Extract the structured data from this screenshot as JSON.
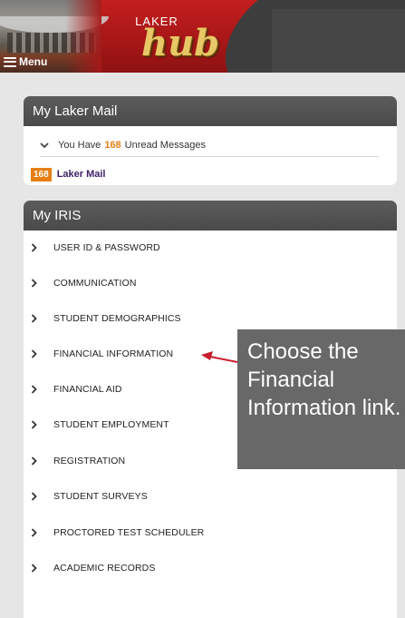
{
  "header": {
    "menu_label": "Menu",
    "logo_top": "LAKER",
    "logo_main": "hub"
  },
  "mail_panel": {
    "title": "My Laker Mail",
    "summary_prefix": "You Have",
    "unread_count": "168",
    "summary_suffix": "Unread Messages",
    "badge": "168",
    "link_label": "Laker Mail"
  },
  "iris_panel": {
    "title": "My IRIS",
    "items": [
      {
        "label": "USER ID & PASSWORD"
      },
      {
        "label": "COMMUNICATION"
      },
      {
        "label": "STUDENT DEMOGRAPHICS"
      },
      {
        "label": "FINANCIAL INFORMATION"
      },
      {
        "label": "FINANCIAL AID"
      },
      {
        "label": "STUDENT EMPLOYMENT"
      },
      {
        "label": "REGISTRATION"
      },
      {
        "label": "STUDENT SURVEYS"
      },
      {
        "label": "PROCTORED TEST SCHEDULER"
      },
      {
        "label": "ACADEMIC RECORDS"
      }
    ]
  },
  "callout": {
    "text": "Choose the Financial Information link."
  },
  "colors": {
    "header_red": "#b01b1b",
    "panel_header": "#525252",
    "accent_orange": "#e67e14",
    "link_purple": "#3e1e66",
    "callout_bg": "#686868",
    "arrow_red": "#c81e2d"
  },
  "icons": {
    "menu": "hamburger-icon",
    "mail_toggle": "chevron-down-icon",
    "list_item": "chevron-right-icon"
  }
}
